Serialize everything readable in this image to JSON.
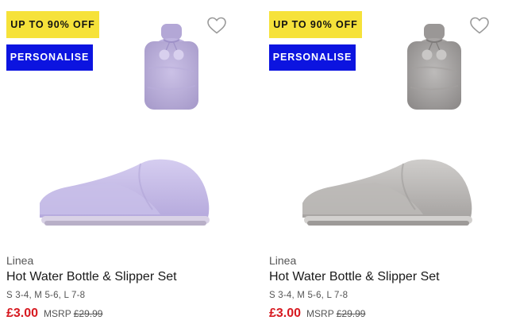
{
  "colors": {
    "sale_badge_bg": "#f6e23a",
    "sale_badge_text": "#111111",
    "personalise_bg": "#0c14e0",
    "personalise_text": "#ffffff",
    "price": "#d71920"
  },
  "products": [
    {
      "sale_badge": "UP TO 90% OFF",
      "personalise_badge": "PERSONALISE",
      "wishlist_icon": "heart-outline-icon",
      "brand": "Linea",
      "title": "Hot Water Bottle & Slipper Set",
      "sizes": "S 3-4, M 5-6, L 7-8",
      "price": "£3.00",
      "msrp_label": "MSRP",
      "msrp_price": "£29.99",
      "product_color": "#bdb2dc"
    },
    {
      "sale_badge": "UP TO 90% OFF",
      "personalise_badge": "PERSONALISE",
      "wishlist_icon": "heart-outline-icon",
      "brand": "Linea",
      "title": "Hot Water Bottle & Slipper Set",
      "sizes": "S 3-4, M 5-6, L 7-8",
      "price": "£3.00",
      "msrp_label": "MSRP",
      "msrp_price": "£29.99",
      "product_color": "#a9a7a6"
    }
  ]
}
